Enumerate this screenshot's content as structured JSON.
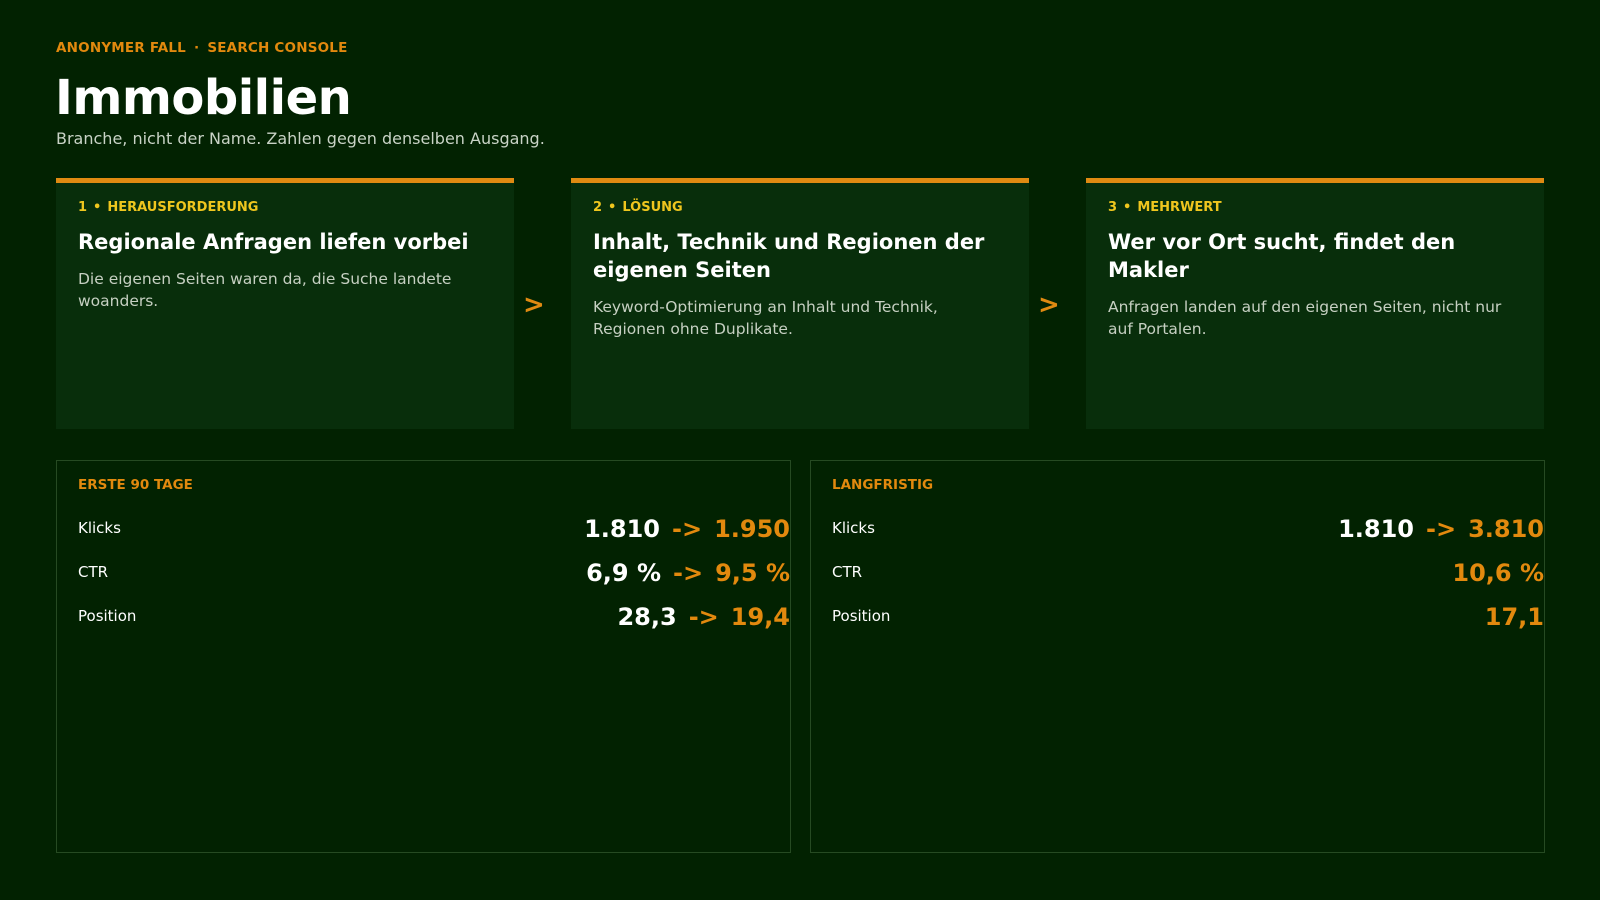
{
  "header": {
    "eyebrow_left": "ANONYMER FALL",
    "eyebrow_sep": "·",
    "eyebrow_right": "SEARCH CONSOLE",
    "title": "Immobilien",
    "subtitle": "Branche, nicht der Name. Zahlen gegen denselben Ausgang."
  },
  "steps": [
    {
      "number": "1",
      "sep": "•",
      "label": "HERAUSFORDERUNG",
      "heading": "Regionale Anfragen liefen vorbei",
      "body": "Die eigenen Seiten waren da, die Suche landete woanders."
    },
    {
      "number": "2",
      "sep": "•",
      "label": "LÖSUNG",
      "heading": "Inhalt, Technik und Regionen der eigenen Seiten",
      "body": "Keyword-Optimierung an Inhalt und Technik, Regionen ohne Duplikate."
    },
    {
      "number": "3",
      "sep": "•",
      "label": "MEHRWERT",
      "heading": "Wer vor Ort sucht, findet den Makler",
      "body": "Anfragen landen auf den eigenen Seiten, nicht nur auf Portalen."
    }
  ],
  "arrow_glyph": ">",
  "panels": [
    {
      "label": "ERSTE 90 TAGE",
      "rows": [
        {
          "name": "Klicks",
          "before": "1.810",
          "arrow": "->",
          "after": "1.950"
        },
        {
          "name": "CTR",
          "before": "6,9 %",
          "arrow": "->",
          "after": "9,5 %"
        },
        {
          "name": "Position",
          "before": "28,3",
          "arrow": "->",
          "after": "19,4"
        }
      ]
    },
    {
      "label": "LANGFRISTIG",
      "rows": [
        {
          "name": "Klicks",
          "before": "1.810",
          "arrow": "->",
          "after": "3.810"
        },
        {
          "name": "CTR",
          "before": "",
          "arrow": "",
          "after": "10,6 %"
        },
        {
          "name": "Position",
          "before": "",
          "arrow": "",
          "after": "17,1"
        }
      ]
    }
  ],
  "colors": {
    "background": "#022201",
    "card": "#082e0b",
    "accent": "#e08a12",
    "label_yellow": "#efc61e"
  }
}
